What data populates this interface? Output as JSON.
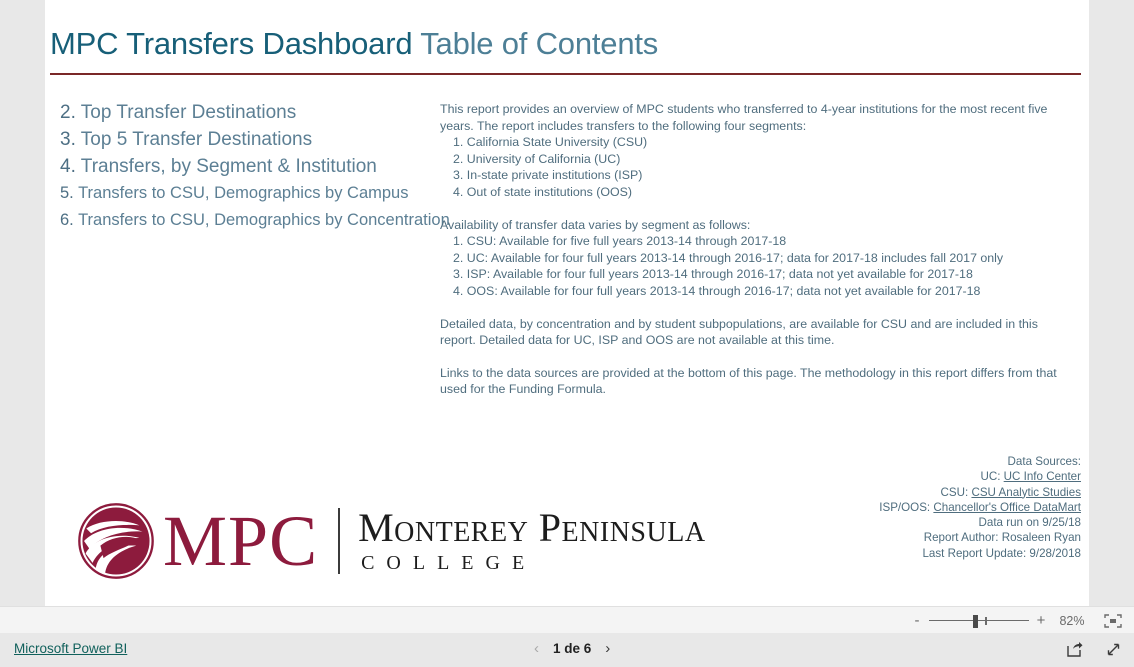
{
  "report": {
    "title_main": "MPC Transfers Dashboard",
    "title_sub": " Table of Contents",
    "accent_rule_color": "#7a2828",
    "title_main_color": "#175f78",
    "title_sub_color": "#4d7f96"
  },
  "toc": {
    "items": [
      {
        "num": "2.",
        "label": "Top Transfer Destinations"
      },
      {
        "num": "3.",
        "label": "Top 5 Transfer Destinations"
      },
      {
        "num": "4.",
        "label": "Transfers, by Segment & Institution"
      },
      {
        "num": "5.",
        "label": "Transfers to CSU, Demographics by Campus"
      },
      {
        "num": "6.",
        "label": "Transfers to CSU, Demographics by Concentration"
      }
    ]
  },
  "body": {
    "intro_line1": "This report provides an overview of MPC students who transferred to 4-year institutions for the most recent five",
    "intro_line2": "years. The report includes transfers to the following four segments:",
    "segments": [
      "1. California State University (CSU)",
      "2. University of California (UC)",
      "3. In-state private institutions (ISP)",
      "4. Out of state institutions (OOS)"
    ],
    "availability_heading": "Availability of transfer data varies by segment as follows:",
    "availability": [
      "1. CSU:  Available for five full years 2013-14 through 2017-18",
      "2. UC: Available for four full years 2013-14 through 2016-17; data for 2017-18 includes fall 2017 only",
      "3. ISP:  Available for four full years 2013-14 through 2016-17; data not yet available for 2017-18",
      "4. OOS: Available for four full years 2013-14 through 2016-17; data not yet available for 2017-18"
    ],
    "detail_line1": "Detailed data, by concentration and by student subpopulations, are available for CSU and are included in this",
    "detail_line2": "report.  Detailed data for UC, ISP and OOS are not available at this time.",
    "links_line1": "Links to the data sources are provided at the bottom of this page.  The methodology in this report differs from that",
    "links_line2": "used for the Funding Formula."
  },
  "sources": {
    "heading": "Data Sources:",
    "uc_prefix": "UC: ",
    "uc_link": "UC Info Center",
    "csu_prefix": "CSU: ",
    "csu_link": "CSU Analytic Studies",
    "isp_prefix": "ISP/OOS: ",
    "isp_link": "Chancellor's Office DataMart",
    "data_run": "Data run on 9/25/18",
    "author": "Report Author: Rosaleen Ryan",
    "last_update": "Last Report Update: 9/28/2018"
  },
  "logo": {
    "mark": "mpc-wave-mark",
    "acronym": "MPC",
    "name_line1": "Monterey Peninsula",
    "name_line2": "COLLEGE",
    "brand_color": "#8d1b3d"
  },
  "zoombar": {
    "zoom_out_label": "-",
    "zoom_in_label": "+",
    "zoom_percent": "82%",
    "fit_icon": "fit-to-page-icon"
  },
  "statusbar": {
    "powerbi_label": "Microsoft Power BI",
    "prev_icon": "chevron-left-icon",
    "next_icon": "chevron-right-icon",
    "page_label": "1 de 6",
    "share_icon": "share-icon",
    "fullscreen_icon": "fullscreen-icon"
  }
}
